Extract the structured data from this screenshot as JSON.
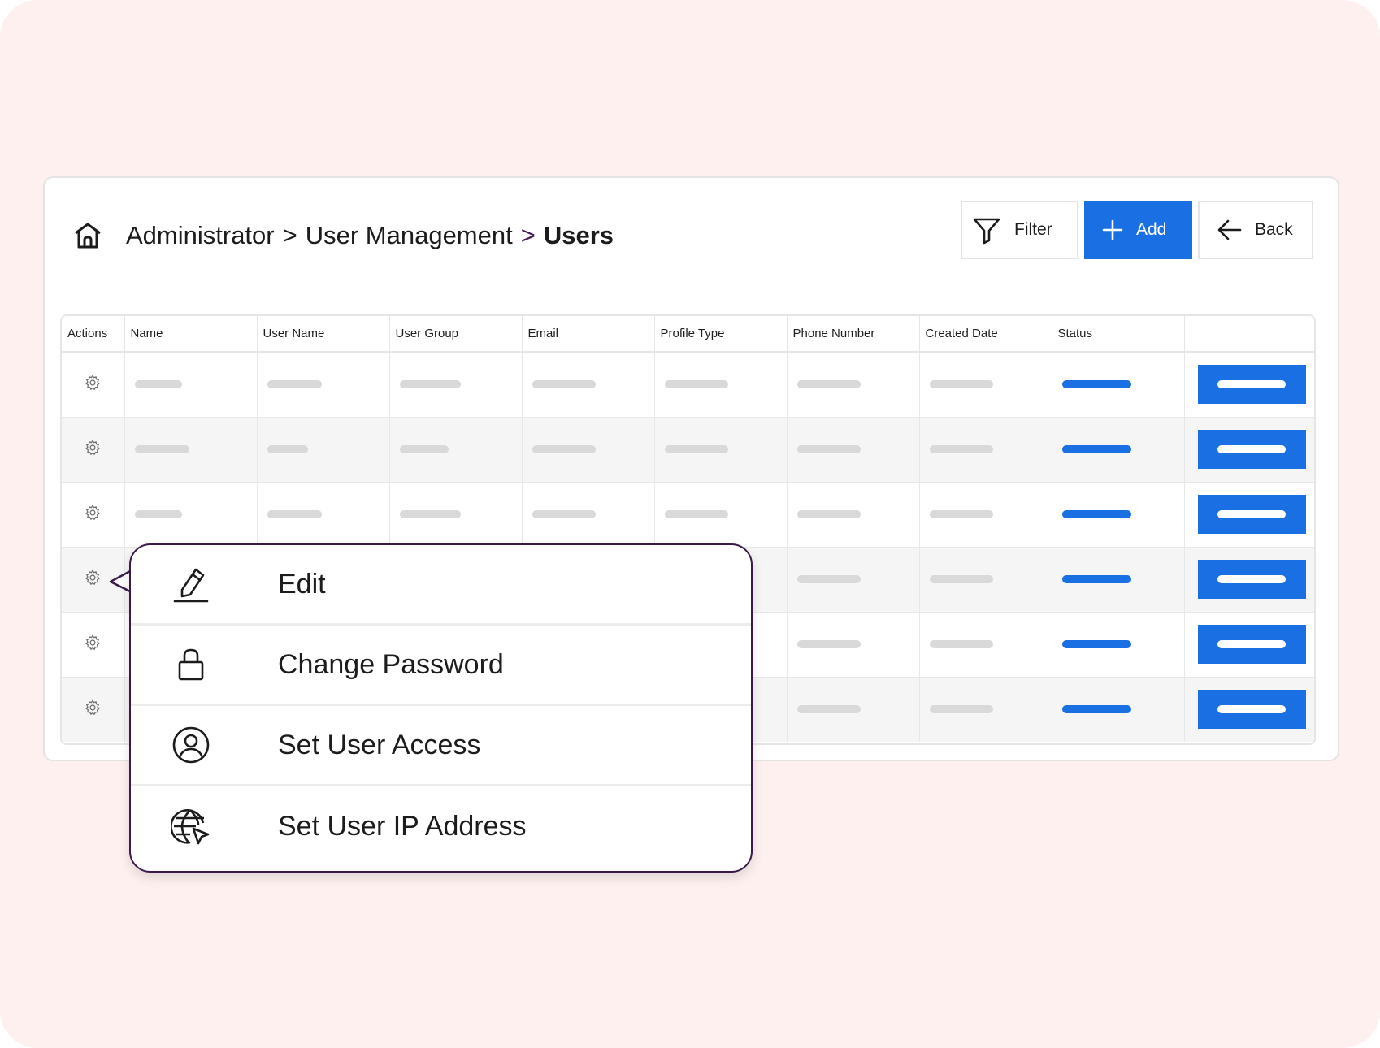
{
  "breadcrumb": {
    "home_icon": "home-icon",
    "items": [
      "Administrator",
      "User Management"
    ],
    "separator": ">",
    "current": "Users"
  },
  "toolbar": {
    "filter_label": "Filter",
    "filter_icon": "filter-icon",
    "add_label": "Add",
    "add_icon": "plus-icon",
    "back_label": "Back",
    "back_icon": "arrow-left-icon"
  },
  "table": {
    "columns": [
      "Actions",
      "Name",
      "User Name",
      "User Group",
      "Email",
      "Profile Type",
      "Phone Number",
      "Created Date",
      "Status",
      ""
    ],
    "row_count": 6,
    "action_icon": "gear-icon"
  },
  "context_menu": {
    "items": [
      {
        "label": "Edit",
        "icon": "edit-pen-icon"
      },
      {
        "label": "Change Password",
        "icon": "lock-icon"
      },
      {
        "label": "Set User Access",
        "icon": "user-circle-icon"
      },
      {
        "label": "Set User IP Address",
        "icon": "globe-cursor-icon"
      }
    ]
  },
  "colors": {
    "accent": "#1a6fe3",
    "background": "#fdf0ef",
    "menu_border": "#3a1a4a",
    "skeleton": "#d9d9d9"
  }
}
